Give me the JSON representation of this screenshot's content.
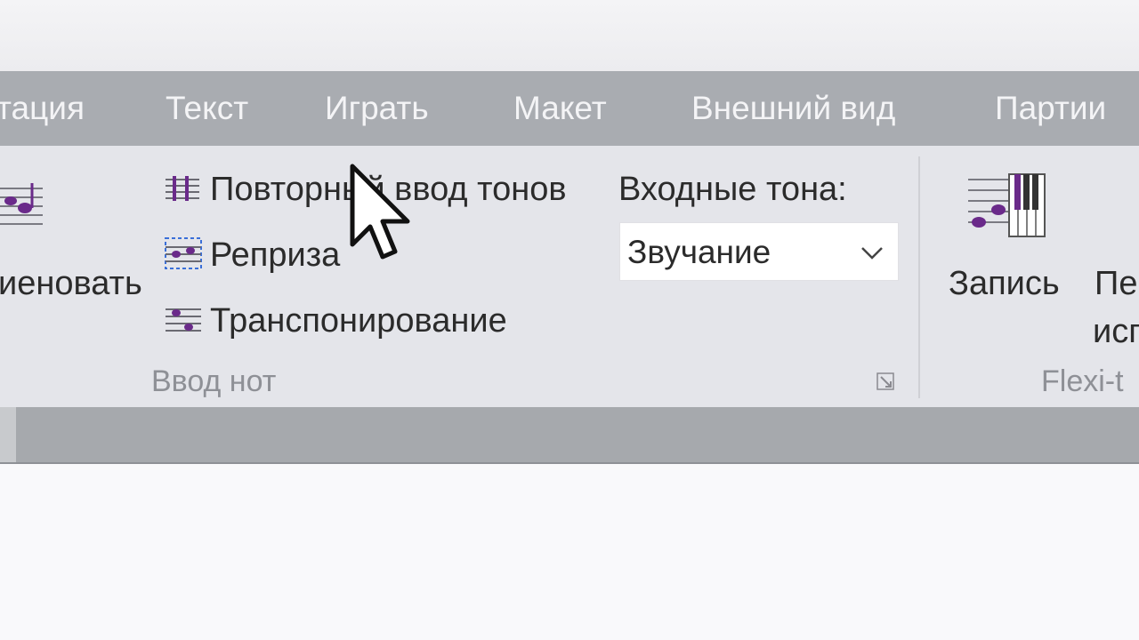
{
  "tabs": [
    {
      "label": "тация"
    },
    {
      "label": "Текст"
    },
    {
      "label": "Играть"
    },
    {
      "label": "Макет"
    },
    {
      "label": "Внешний вид"
    },
    {
      "label": "Партии"
    }
  ],
  "ribbon": {
    "left_partial_label": "иеновать",
    "note_input": {
      "repeat_pitches_label": "Повторный ввод тонов",
      "reprise_label": "Реприза",
      "transpose_label": "Транспонирование",
      "group_label": "Ввод нот"
    },
    "input_pitches": {
      "label": "Входные тона:",
      "selected": "Звучание"
    },
    "flexi_time": {
      "record_label": "Запись",
      "next_label_line1": "Пе",
      "next_label_line2": "исп",
      "group_label": "Flexi-t"
    }
  },
  "colors": {
    "tab_bar": "#a9acb1",
    "ribbon_bg": "#e4e5ea",
    "accent_purple": "#6a2a8a",
    "status_bar": "#a6a9ad"
  },
  "icons": {
    "left_partial": "staff-note-icon",
    "repeat_pitches": "staff-lines-icon",
    "reprise": "reprise-icon",
    "transpose": "transpose-icon",
    "record": "record-piano-icon",
    "chevron": "chevron-down-icon",
    "launcher": "dialog-launcher-icon",
    "cursor": "mouse-cursor"
  }
}
